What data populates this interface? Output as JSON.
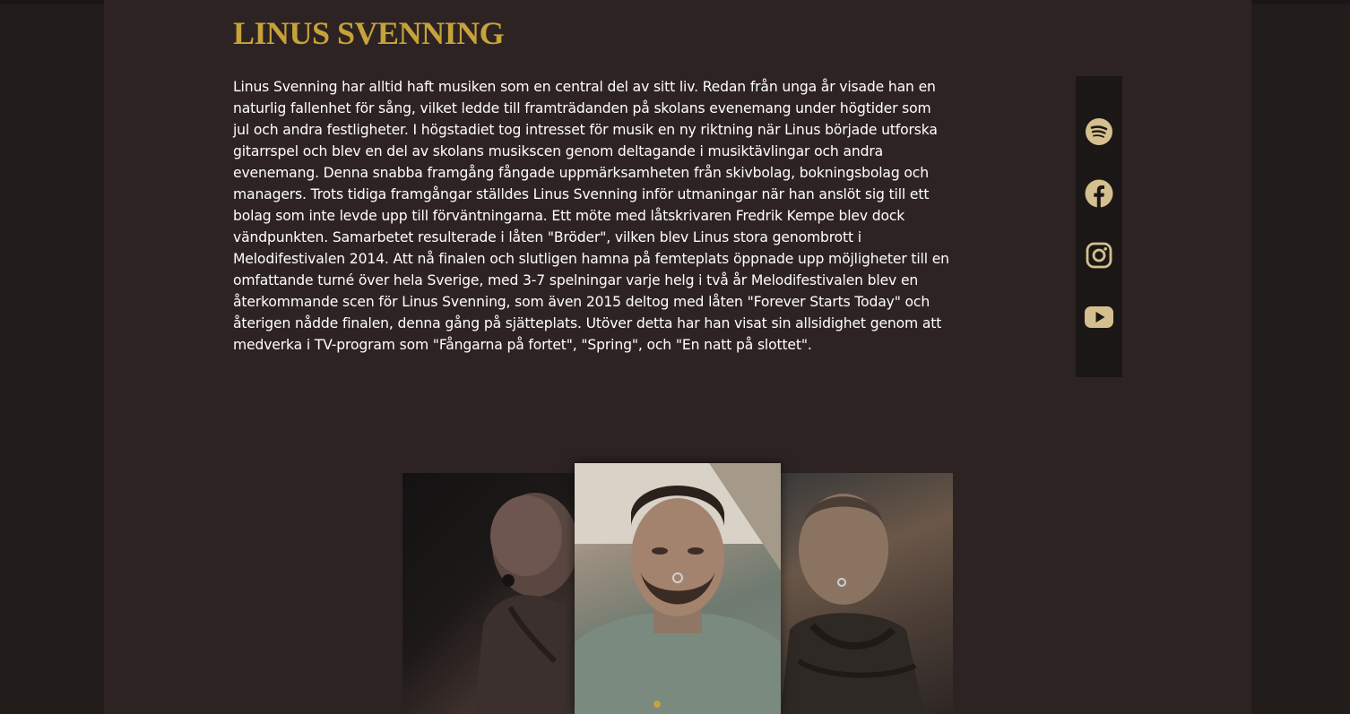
{
  "header": {
    "title": "LINUS SVENNING"
  },
  "bio": {
    "text": "Linus Svenning har alltid haft musiken som en central del av sitt liv. Redan från unga år visade han en naturlig fallenhet för sång, vilket ledde till framträdanden på skolans evenemang under högtider som jul och andra festligheter. I högstadiet tog intresset för musik en ny riktning när Linus började utforska gitarrspel och blev en del av skolans musikscen genom deltagande i musiktävlingar och andra evenemang. Denna snabba framgång fångade uppmärksamheten från skivbolag, bokningsbolag och managers. Trots tidiga framgångar ställdes Linus Svenning inför utmaningar när han anslöt sig till ett bolag som inte levde upp till förväntningarna. Ett möte med låtskrivaren Fredrik Kempe blev dock vändpunkten. Samarbetet resulterade i låten \"Bröder\", vilken blev Linus stora genombrott i Melodifestivalen 2014. Att nå finalen och slutligen hamna på femteplats öppnade upp möjligheter till en omfattande turné över hela Sverige, med 3-7 spelningar varje helg i två år Melodifestivalen blev en återkommande scen för Linus Svenning, som även 2015 deltog med låten \"Forever Starts Today\" och återigen nådde finalen, denna gång på sjätteplats. Utöver detta har han visat sin allsidighet genom att medverka i TV-program som \"Fångarna på fortet\", \"Spring\", och \"En natt på slottet\"."
  },
  "social": {
    "icons": [
      "spotify-icon",
      "facebook-icon",
      "instagram-icon",
      "youtube-icon"
    ],
    "icon_color": "#d4c08f",
    "bar_color": "#1b1716"
  },
  "gallery": {
    "photos": [
      "photo-left",
      "photo-center",
      "photo-right"
    ]
  },
  "colors": {
    "accent": "#c6a23a",
    "background": "#221d1b",
    "panel": "#2d2322",
    "text": "#ffffff"
  }
}
